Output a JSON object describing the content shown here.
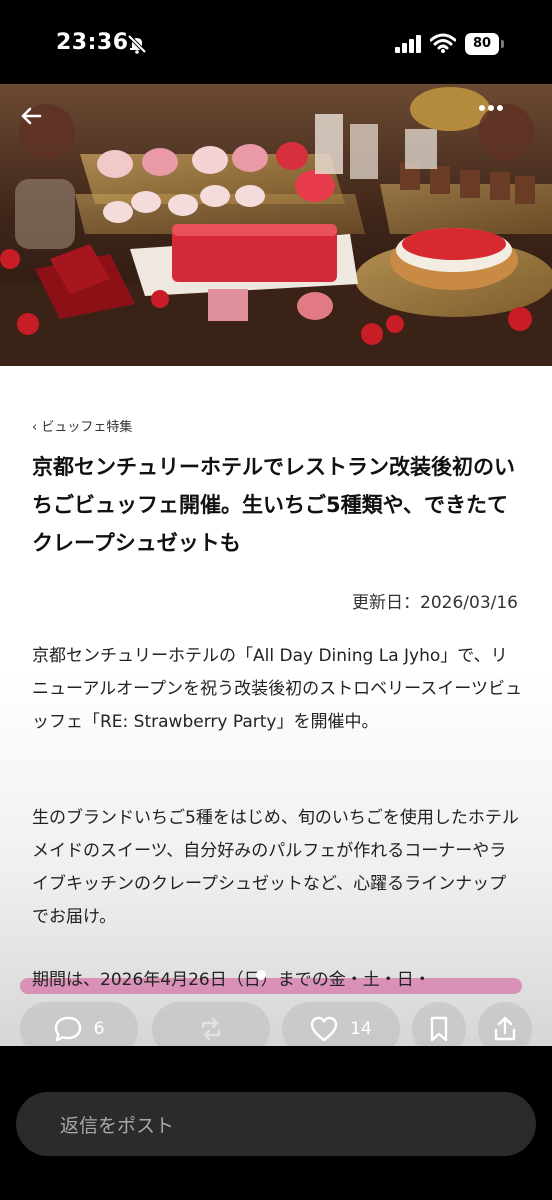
{
  "status_bar": {
    "time": "23:36",
    "battery": "80"
  },
  "hero": {
    "description_icon": "strawberry-buffet-photo"
  },
  "article": {
    "breadcrumb": "‹ ビュッフェ特集",
    "title": "京都センチュリーホテルでレストラン改装後初のいちごビュッフェ開催。生いちご5種類や、できたてクレープシュゼットも",
    "updated": "更新日：2026/03/16",
    "paragraph1": "京都センチュリーホテルの「All Day Dining La Jyho」で、リニューアルオープンを祝う改装後初のストロベリースイーツビュッフェ「RE: Strawberry Party」を開催中。",
    "paragraph2": "生のブランドいちご5種をはじめ、旬のいちごを使用したホテルメイドのスイーツ、自分好みのパルフェが作れるコーナーやライブキッチンのクレープシュゼットなど、心躍るラインナップでお届け。",
    "paragraph3": "期間は、2026年4月26日（日）までの金・土・日・"
  },
  "actions": {
    "comment_count": "6",
    "like_count": "14"
  },
  "reply": {
    "placeholder": "返信をポスト"
  },
  "colors": {
    "highlight": "#d65096",
    "hero_button": "#5f3223"
  }
}
